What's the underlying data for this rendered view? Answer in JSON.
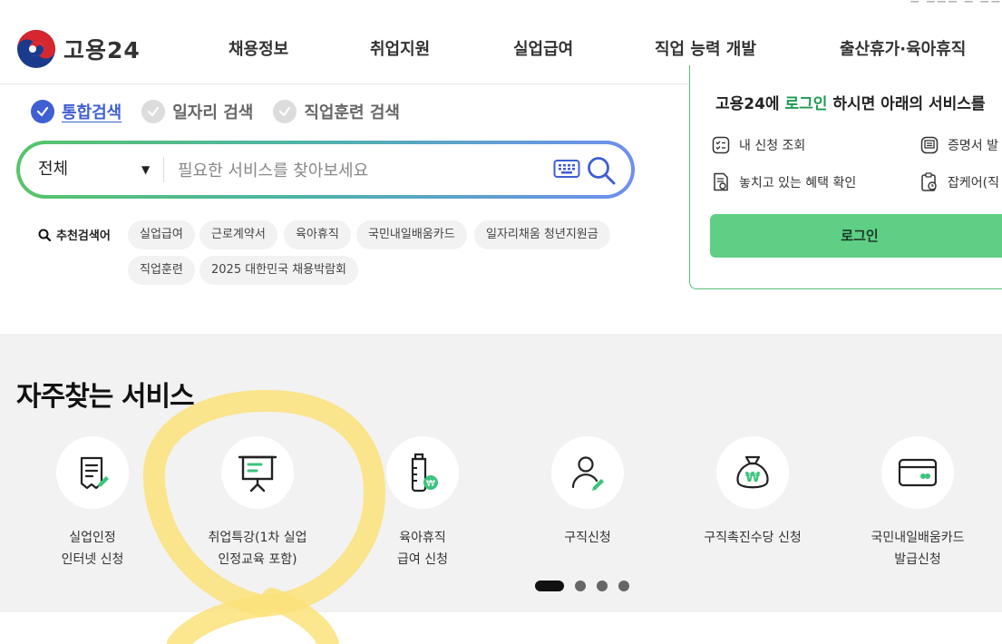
{
  "header": {
    "logo_text": "고용24",
    "nav": [
      "채용정보",
      "취업지원",
      "실업급여",
      "직업 능력 개발",
      "출산휴가·육아휴직"
    ]
  },
  "search": {
    "tabs": [
      "통합검색",
      "일자리 검색",
      "직업훈련 검색"
    ],
    "active_tab": 0,
    "category": "전체",
    "placeholder": "필요한 서비스를 찾아보세요",
    "recommend_label": "추천검색어",
    "chips": [
      "실업급여",
      "근로계약서",
      "육아휴직",
      "국민내일배움카드",
      "일자리채움 청년지원금",
      "직업훈련",
      "2025 대한민국 채용박람회"
    ]
  },
  "login_panel": {
    "msg_prefix": "고용24에 ",
    "msg_link": "로그인",
    "msg_suffix": " 하시면 아래의 서비스를",
    "items": [
      "내 신청 조회",
      "증명서 발",
      "놓치고 있는 혜택 확인",
      "잡케어(직"
    ],
    "button": "로그인"
  },
  "frequent": {
    "title": "자주찾는 서비스",
    "services": [
      {
        "line1": "실업인정",
        "line2": "인터넷 신청",
        "icon": "document-pen-icon"
      },
      {
        "line1": "취업특강(1차 실업",
        "line2": "인정교육 포함)",
        "icon": "presentation-board-icon"
      },
      {
        "line1": "육아휴직",
        "line2": "급여 신청",
        "icon": "baby-bottle-won-icon"
      },
      {
        "line1": "구직신청",
        "line2": "",
        "icon": "person-pen-icon"
      },
      {
        "line1": "구직촉진수당 신청",
        "line2": "",
        "icon": "money-bag-icon"
      },
      {
        "line1": "국민내일배움카드",
        "line2": "발급신청",
        "icon": "card-icon"
      }
    ],
    "pages": 4,
    "current_page": 1
  },
  "colors": {
    "brand_green": "#1f9a52",
    "login_button": "#5fcf86",
    "active_tab": "#3f5fd2",
    "highlighter": "#fbe27a"
  }
}
